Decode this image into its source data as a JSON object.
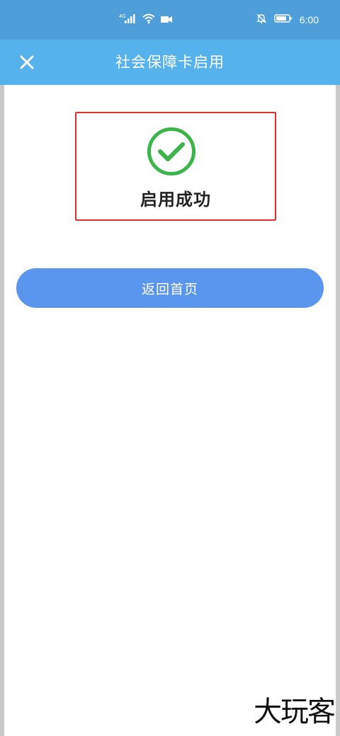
{
  "status_bar": {
    "network_label": "4G",
    "time": "6:00"
  },
  "nav": {
    "title": "社会保障卡启用"
  },
  "result": {
    "message": "启用成功"
  },
  "actions": {
    "home_label": "返回首页"
  },
  "watermark": {
    "text": "大玩客"
  },
  "colors": {
    "status_bar": "#4e9fd9",
    "nav_bar": "#56b2ec",
    "button": "#5a95ee",
    "success_green": "#3bb54a",
    "highlight_red": "#e0302c"
  },
  "icons": {
    "close": "close-icon",
    "success": "check-circle-icon",
    "signal": "signal-icon",
    "wifi": "wifi-icon",
    "video": "video-icon",
    "mute": "bell-off-icon",
    "battery": "battery-icon"
  }
}
